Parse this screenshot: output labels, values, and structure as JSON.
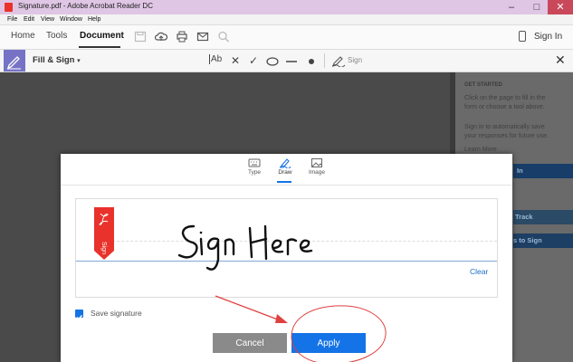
{
  "window": {
    "title": "Signature.pdf - Adobe Acrobat Reader DC"
  },
  "menu": [
    "File",
    "Edit",
    "View",
    "Window",
    "Help"
  ],
  "toolbar": {
    "tabs": [
      "Home",
      "Tools",
      "Document"
    ],
    "active_tab": "Document",
    "sign_in": "Sign In"
  },
  "fillsign": {
    "title": "Fill & Sign",
    "text_tool": "Ab",
    "sign_label": "Sign"
  },
  "right_panel": {
    "heading": "GET STARTED",
    "line1": "Click on the page to fill in the",
    "line2": "form or choose a tool above.",
    "line3": "Sign in to automatically save",
    "line4": "your responses for future use.",
    "line5": "Learn More",
    "button1": "In",
    "button2": "Track",
    "button3": "s to Sign"
  },
  "dialog": {
    "tabs": [
      {
        "label": "Type",
        "icon": "keyboard-icon"
      },
      {
        "label": "Draw",
        "icon": "pen-icon"
      },
      {
        "label": "Image",
        "icon": "image-icon"
      }
    ],
    "selected_tab": "Draw",
    "signature_text": "Sign Here",
    "ribbon_label": "Sign",
    "clear_label": "Clear",
    "save_signature_label": "Save signature",
    "save_signature_checked": true,
    "cancel_label": "Cancel",
    "apply_label": "Apply"
  },
  "colors": {
    "accent": "#1473e6",
    "fill_sign_badge": "#7673c7",
    "pdf_red": "#e9322b",
    "annotation_red": "#e04040"
  }
}
